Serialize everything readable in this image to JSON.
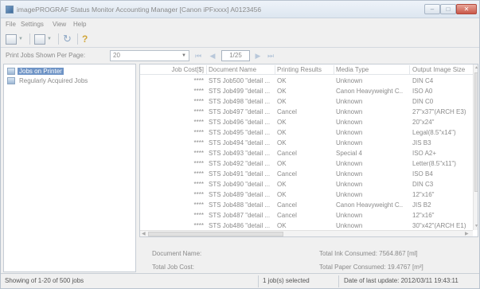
{
  "window": {
    "title": "imagePROGRAF Status Monitor Accounting Manager [Canon iPFxxxx]  A0123456",
    "controls": {
      "minimize": "–",
      "maximize": "□",
      "close": "✕"
    }
  },
  "menu": [
    "File",
    "Settings",
    "View",
    "Help"
  ],
  "toolbar": {
    "icons": [
      "save-icon",
      "properties-icon",
      "refresh-icon",
      "help-icon"
    ],
    "refresh_glyph": "↻",
    "help_glyph": "?"
  },
  "pager": {
    "label": "Print Jobs Shown Per Page:",
    "per_page": "20",
    "page_indicator": "1/25",
    "first": "⏮",
    "prev": "◀",
    "next": "▶",
    "last": "⏭"
  },
  "tree": {
    "items": [
      {
        "label": "Jobs on Printer",
        "selected": true
      },
      {
        "label": "Regularly Acquired Jobs",
        "selected": false
      }
    ]
  },
  "grid": {
    "columns": [
      "Job Cost[$]",
      "Document Name",
      "Printing Results",
      "Media Type",
      "Output Image Size"
    ],
    "rows": [
      [
        "****",
        "STS Job500 \"detail ...",
        "OK",
        "Unknown",
        "DIN C4"
      ],
      [
        "****",
        "STS Job499 \"detail ...",
        "OK",
        "Canon Heavyweight C...",
        "ISO A0"
      ],
      [
        "****",
        "STS Job498 \"detail ...",
        "OK",
        "Unknown",
        "DIN C0"
      ],
      [
        "****",
        "STS Job497 \"detail ...",
        "Cancel",
        "Unknown",
        "27\"x37\"(ARCH E3)"
      ],
      [
        "****",
        "STS Job496 \"detail ...",
        "OK",
        "Unknown",
        "20\"x24\""
      ],
      [
        "****",
        "STS Job495 \"detail ...",
        "OK",
        "Unknown",
        "Legal(8.5\"x14\")"
      ],
      [
        "****",
        "STS Job494 \"detail ...",
        "OK",
        "Unknown",
        "JIS B3"
      ],
      [
        "****",
        "STS Job493 \"detail ...",
        "Cancel",
        "Special 4",
        "ISO A2+"
      ],
      [
        "****",
        "STS Job492 \"detail ...",
        "OK",
        "Unknown",
        "Letter(8.5\"x11\")"
      ],
      [
        "****",
        "STS Job491 \"detail ...",
        "Cancel",
        "Unknown",
        "ISO B4"
      ],
      [
        "****",
        "STS Job490 \"detail ...",
        "OK",
        "Unknown",
        "DIN C3"
      ],
      [
        "****",
        "STS Job489 \"detail ...",
        "OK",
        "Unknown",
        "12\"x16\""
      ],
      [
        "****",
        "STS Job488 \"detail ...",
        "Cancel",
        "Canon Heavyweight C...",
        "JIS B2"
      ],
      [
        "****",
        "STS Job487 \"detail ...",
        "Cancel",
        "Unknown",
        "12\"x16\""
      ],
      [
        "****",
        "STS Job486 \"detail ...",
        "OK",
        "Unknown",
        "30\"x42\"(ARCH E1)"
      ]
    ]
  },
  "details": {
    "document_name_label": "Document Name:",
    "total_job_cost_label": "Total Job Cost:",
    "total_ink": "Total Ink Consumed: 7564.867 [ml]",
    "total_paper": "Total Paper Consumed: 19.4767 [m²]"
  },
  "status": {
    "showing": "Showing of 1-20 of 500 jobs",
    "selected": "1 job(s) selected",
    "last_update": "Date of last update: 2012/03/11 19:43:11"
  },
  "colors": {
    "selection": "#6f94c6",
    "close_button": "#c9584a"
  }
}
